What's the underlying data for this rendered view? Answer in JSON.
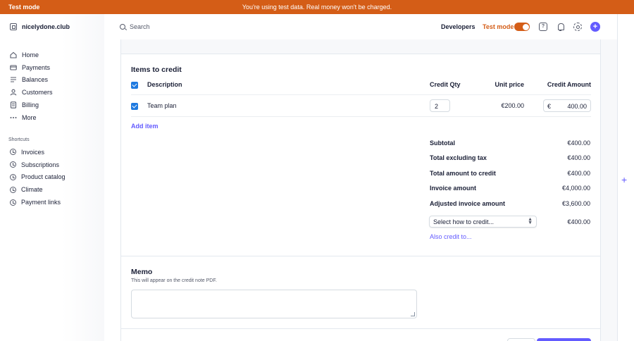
{
  "banner": {
    "label": "Test mode",
    "message": "You're using test data. Real money won't be charged."
  },
  "account": {
    "name": "nicelydone.club"
  },
  "nav": {
    "items": [
      {
        "label": "Home",
        "icon": "home-icon"
      },
      {
        "label": "Payments",
        "icon": "payments-icon"
      },
      {
        "label": "Balances",
        "icon": "balances-icon"
      },
      {
        "label": "Customers",
        "icon": "customers-icon"
      },
      {
        "label": "Billing",
        "icon": "billing-icon"
      },
      {
        "label": "More",
        "icon": "more-icon"
      }
    ],
    "shortcuts_heading": "Shortcuts",
    "shortcuts": [
      {
        "label": "Invoices"
      },
      {
        "label": "Subscriptions"
      },
      {
        "label": "Product catalog"
      },
      {
        "label": "Climate"
      },
      {
        "label": "Payment links"
      }
    ]
  },
  "topbar": {
    "search_placeholder": "Search",
    "developers": "Developers",
    "test_mode_label": "Test mode",
    "test_mode_on": true
  },
  "items": {
    "heading": "Items to credit",
    "columns": {
      "description": "Description",
      "credit_qty": "Credit Qty",
      "unit_price": "Unit price",
      "credit_amount": "Credit Amount"
    },
    "rows": [
      {
        "description": "Team plan",
        "qty": "2",
        "unit_price": "€200.00",
        "currency": "€",
        "amount": "400.00",
        "checked": true
      }
    ],
    "add_item": "Add item"
  },
  "summary": {
    "rows": [
      {
        "label": "Subtotal",
        "value": "€400.00"
      },
      {
        "label": "Total excluding tax",
        "value": "€400.00"
      },
      {
        "label": "Total amount to credit",
        "value": "€400.00"
      },
      {
        "label": "Invoice amount",
        "value": "€4,000.00"
      },
      {
        "label": "Adjusted invoice amount",
        "value": "€3,600.00"
      }
    ],
    "select_placeholder": "Select how to credit...",
    "select_value": "€400.00",
    "also_credit": "Also credit to..."
  },
  "memo": {
    "heading": "Memo",
    "subtitle": "This will appear on the credit note PDF.",
    "value": ""
  },
  "colors": {
    "banner": "#d45d17",
    "accent": "#635bff",
    "checkbox": "#1f7ae0"
  }
}
